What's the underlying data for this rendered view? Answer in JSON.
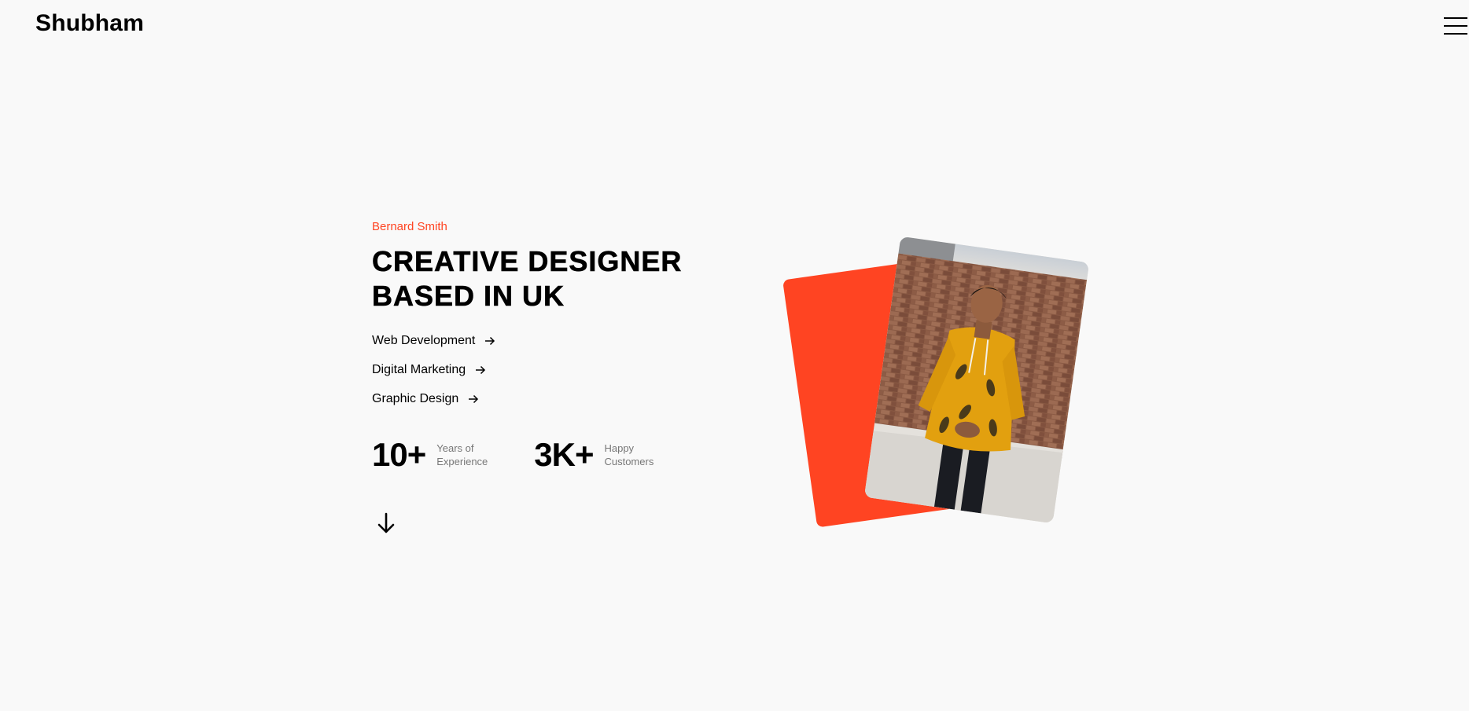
{
  "header": {
    "logo": "Shubham",
    "menu_icon": "hamburger-menu-icon"
  },
  "hero": {
    "eyebrow": "Bernard Smith",
    "headline_line1": "CREATIVE DESIGNER",
    "headline_line2": "BASED IN UK",
    "services": [
      {
        "label": "Web Development",
        "icon": "arrow-right-icon"
      },
      {
        "label": "Digital Marketing",
        "icon": "arrow-right-icon"
      },
      {
        "label": "Graphic Design",
        "icon": "arrow-right-icon"
      }
    ],
    "stats": [
      {
        "value": "10+",
        "label_line1": "Years of",
        "label_line2": "Experience"
      },
      {
        "value": "3K+",
        "label_line1": "Happy",
        "label_line2": "Customers"
      }
    ],
    "scroll_icon": "arrow-down-icon"
  },
  "colors": {
    "accent": "#ff4422",
    "background": "#f9f9f9",
    "text": "#000000",
    "muted": "#777777"
  }
}
